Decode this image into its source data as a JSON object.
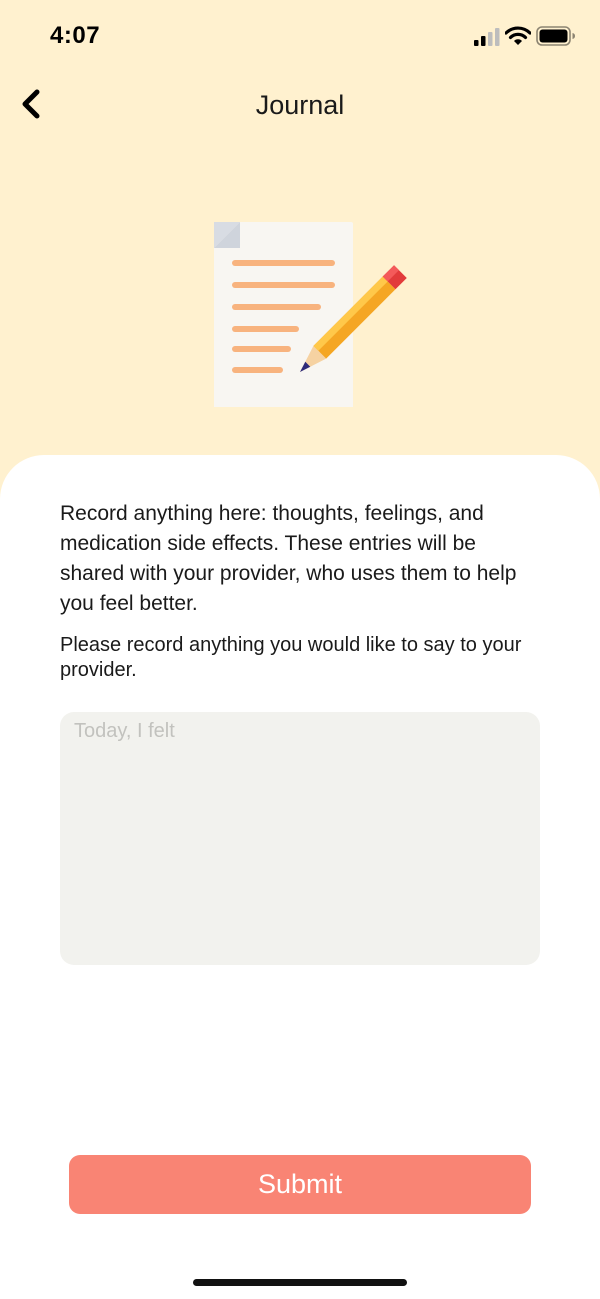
{
  "status_bar": {
    "time": "4:07",
    "icons": [
      "cellular-signal-icon",
      "wifi-icon",
      "battery-icon"
    ]
  },
  "header": {
    "title": "Journal",
    "back_icon": "chevron-left-icon"
  },
  "hero": {
    "icon": "document-pencil-illustration"
  },
  "content": {
    "intro": "Record anything here: thoughts, feelings, and medication side effects. These entries will be shared with your provider, who uses them to help you feel better.",
    "prompt": "Please record anything you would like to say to your provider.",
    "input": {
      "placeholder": "Today, I felt",
      "value": ""
    },
    "submit_label": "Submit"
  },
  "colors": {
    "header_background": "#FFF1CF",
    "card_background": "#FFFFFF",
    "input_background": "#F2F2EE",
    "submit_background": "#F98474",
    "submit_text": "#FFFFFF"
  }
}
